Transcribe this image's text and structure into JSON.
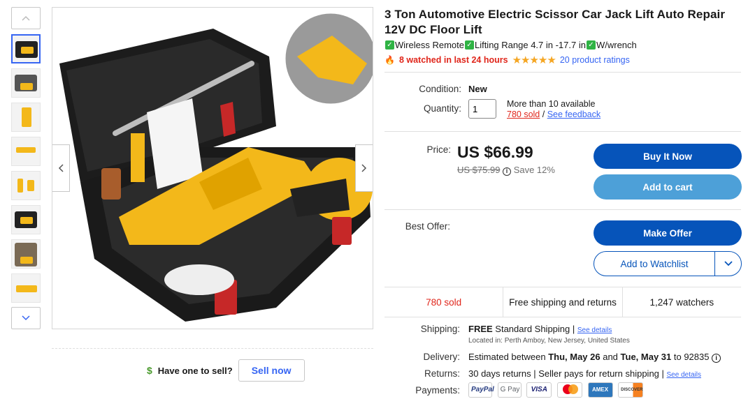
{
  "product": {
    "title": "3 Ton Automotive Electric Scissor Car Jack Lift Auto Repair 12V DC Floor Lift",
    "features": [
      "Wireless Remote",
      "Lifting Range 4.7 in -17.7 in",
      "W/wrench"
    ],
    "watched_text": "8 watched in last 24 hours",
    "rating_stars": "★★★★★",
    "ratings_link": "20 product ratings"
  },
  "details": {
    "condition_label": "Condition:",
    "condition_value": "New",
    "quantity_label": "Quantity:",
    "quantity_value": "1",
    "available": "More than 10 available",
    "sold_link": "780 sold",
    "slash": " / ",
    "feedback_link": "See feedback"
  },
  "price": {
    "label": "Price:",
    "current": "US $66.99",
    "was": "US $75.99",
    "save": "Save 12%",
    "info_icon": "info-icon"
  },
  "buttons": {
    "buy_now": "Buy It Now",
    "add_to_cart": "Add to cart",
    "best_offer_label": "Best Offer:",
    "make_offer": "Make Offer",
    "watchlist": "Add to Watchlist"
  },
  "stats": {
    "sold": "780 sold",
    "shipping": "Free shipping and returns",
    "watchers": "1,247 watchers"
  },
  "shipping": {
    "label": "Shipping:",
    "free": "FREE",
    "method": " Standard Shipping | ",
    "see_details": "See details",
    "location": "Located in: Perth Amboy, New Jersey, United States"
  },
  "delivery": {
    "label": "Delivery:",
    "prefix": "Estimated between ",
    "from": "Thu, May 26",
    "and": " and ",
    "to": "Tue, May 31",
    "suffix": " to 92835 "
  },
  "returns": {
    "label": "Returns:",
    "text": "30 days returns | Seller pays for return shipping | ",
    "see_details": "See details"
  },
  "payments": {
    "label": "Payments:",
    "methods": [
      "PayPal",
      "G Pay",
      "VISA",
      "MC",
      "AMEX",
      "DISCOVER"
    ]
  },
  "sell": {
    "question": "Have one to sell?",
    "button": "Sell now"
  },
  "colors": {
    "accent": "#3665f3",
    "primary_button": "#0654ba",
    "secondary_button": "#4da0d8",
    "alert_red": "#e0261b",
    "star": "#f5a623",
    "check_green": "#2fb344",
    "product_yellow": "#f3b81a"
  }
}
